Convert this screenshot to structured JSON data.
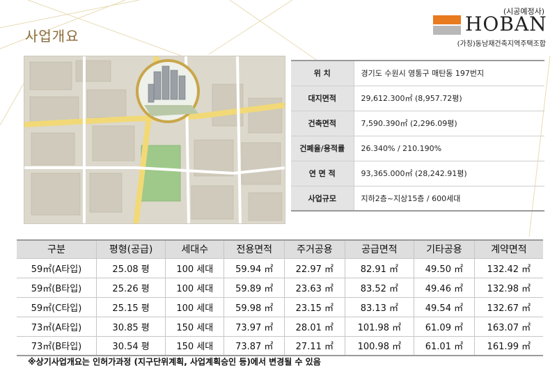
{
  "page": {
    "title": "사업개요",
    "logo_top": "(시공예정사)",
    "logo_brand": "HOBAN",
    "logo_caption": "(가칭)동남재건축지역주택조합"
  },
  "colors": {
    "accent": "#e87a1f",
    "gold": "#c9a64a",
    "header_bg": "#dedede"
  },
  "overview": [
    {
      "label": "위     치",
      "value": "경기도 수원시 영통구 매탄동 197번지"
    },
    {
      "label": "대지면적",
      "value": "29,612.300㎡ (8,957.72평)"
    },
    {
      "label": "건축면적",
      "value": "7,590.390㎡ (2,296.09평)"
    },
    {
      "label": "건폐율/용적률",
      "value": "26.340% / 210.190%"
    },
    {
      "label": "연 면 적",
      "value": "93,365.000㎡ (28,242.91평)"
    },
    {
      "label": "사업규모",
      "value": "지하2층~지상15층 / 600세대"
    }
  ],
  "units_table": {
    "headers": [
      "구분",
      "평형(공급)",
      "세대수",
      "전용면적",
      "주거공용",
      "공급면적",
      "기타공용",
      "계약면적"
    ],
    "rows": [
      [
        "59㎡(A타입)",
        "25.08 평",
        "100 세대",
        "59.94 ㎡",
        "22.97 ㎡",
        "82.91 ㎡",
        "49.50 ㎡",
        "132.42 ㎡"
      ],
      [
        "59㎡(B타입)",
        "25.26 평",
        "100 세대",
        "59.89 ㎡",
        "23.63 ㎡",
        "83.52 ㎡",
        "49.46 ㎡",
        "132.98 ㎡"
      ],
      [
        "59㎡(C타입)",
        "25.15 평",
        "100 세대",
        "59.98 ㎡",
        "23.15 ㎡",
        "83.13 ㎡",
        "49.54 ㎡",
        "132.67 ㎡"
      ],
      [
        "73㎡(A타입)",
        "30.85 평",
        "150 세대",
        "73.97 ㎡",
        "28.01 ㎡",
        "101.98 ㎡",
        "61.09 ㎡",
        "163.07 ㎡"
      ],
      [
        "73㎡(B타입)",
        "30.54 평",
        "150 세대",
        "73.87 ㎡",
        "27.11 ㎡",
        "100.98 ㎡",
        "61.01 ㎡",
        "161.99 ㎡"
      ]
    ]
  },
  "note": "※상기사업개요는 인허가과정 (지구단위계획, 사업계획승인 등)에서 변경될 수 있음"
}
